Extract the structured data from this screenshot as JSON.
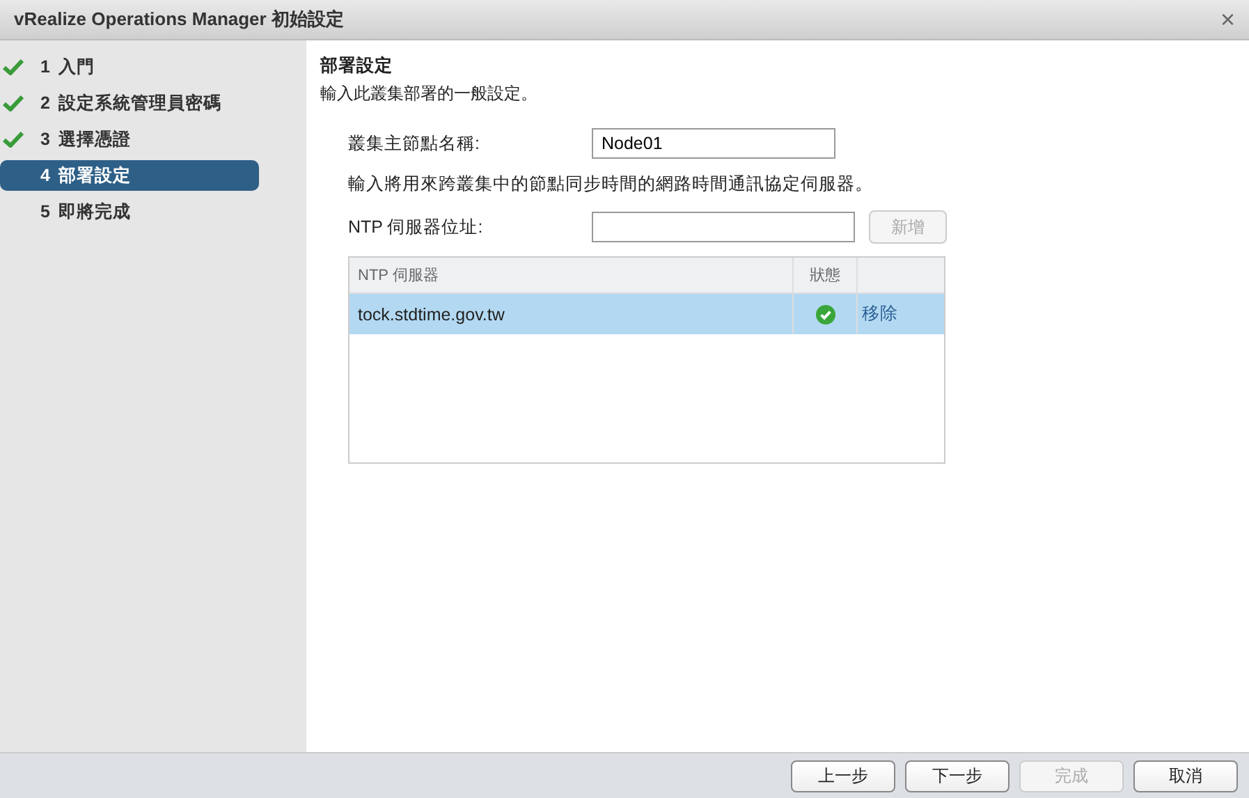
{
  "window": {
    "title": "vRealize Operations Manager 初始設定",
    "close": "×"
  },
  "steps": [
    {
      "number": "1",
      "label": "入門",
      "done": true,
      "selected": false
    },
    {
      "number": "2",
      "label": "設定系統管理員密碼",
      "done": true,
      "selected": false
    },
    {
      "number": "3",
      "label": "選擇憑證",
      "done": true,
      "selected": false
    },
    {
      "number": "4",
      "label": "部署設定",
      "done": false,
      "selected": true
    },
    {
      "number": "5",
      "label": "即將完成",
      "done": false,
      "selected": false
    }
  ],
  "page": {
    "heading": "部署設定",
    "description": "輸入此叢集部署的一般設定。",
    "node_name": {
      "label": "叢集主節點名稱:",
      "value": "Node01"
    },
    "ntp_hint": "輸入將用來跨叢集中的節點同步時間的網路時間通訊協定伺服器。",
    "ntp_address": {
      "label": "NTP 伺服器位址:",
      "add_button": {
        "label": "新增",
        "disabled": true
      }
    },
    "table": {
      "columns": [
        "NTP 伺服器",
        "狀態"
      ],
      "rows": [
        {
          "server": "tock.stdtime.gov.tw",
          "status_ok": true,
          "action": "移除",
          "selected": true
        }
      ]
    }
  },
  "footer_buttons": [
    {
      "label": "上一步",
      "disabled": false
    },
    {
      "label": "下一步",
      "disabled": false
    },
    {
      "label": "完成",
      "disabled": true
    },
    {
      "label": "取消",
      "disabled": false
    }
  ]
}
